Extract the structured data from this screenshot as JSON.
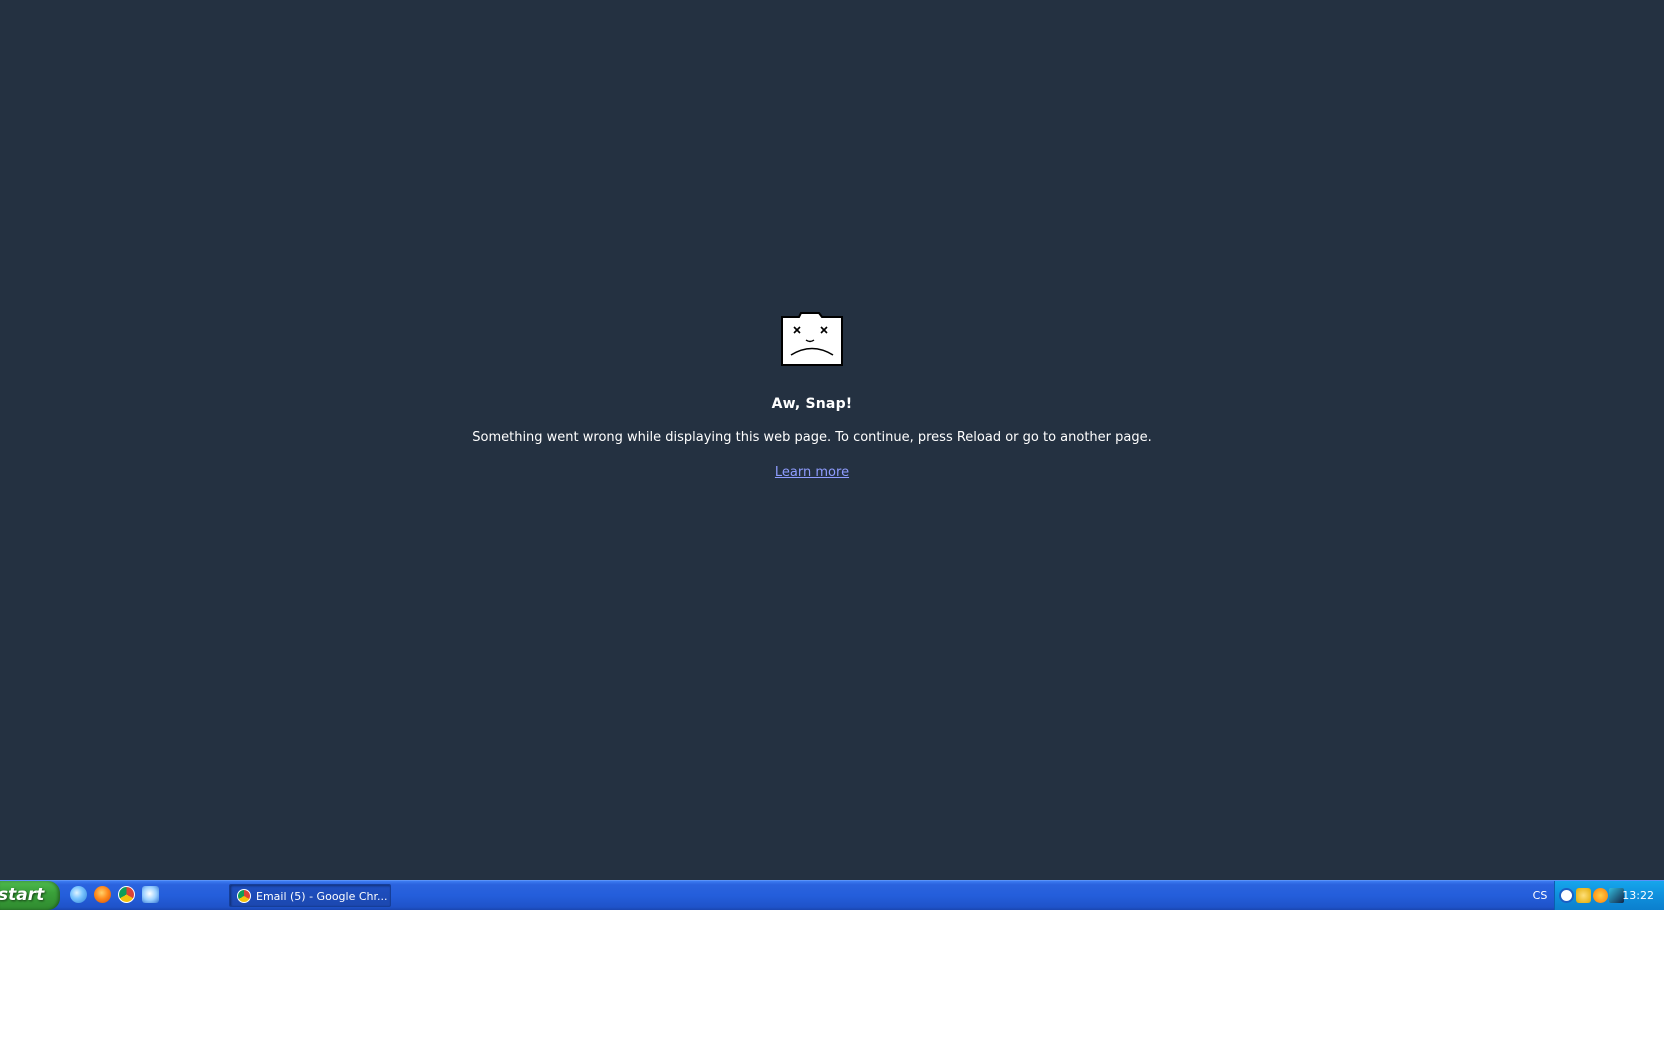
{
  "error": {
    "title": "Aw, Snap!",
    "message": "Something went wrong while displaying this web page. To continue, press Reload or go to another page.",
    "link_label": "Learn more"
  },
  "taskbar": {
    "start_label": "start",
    "quick_launch": [
      "internet-explorer-icon",
      "firefox-icon",
      "chrome-icon",
      "show-desktop-icon"
    ],
    "task_button_label": "Email (5) - Google Chr...",
    "language_indicator": "CS",
    "clock": "13:22"
  },
  "colors": {
    "page_background": "#243141",
    "link": "#8f9dff",
    "taskbar": "#245edb",
    "start_button": "#3aa13a"
  }
}
